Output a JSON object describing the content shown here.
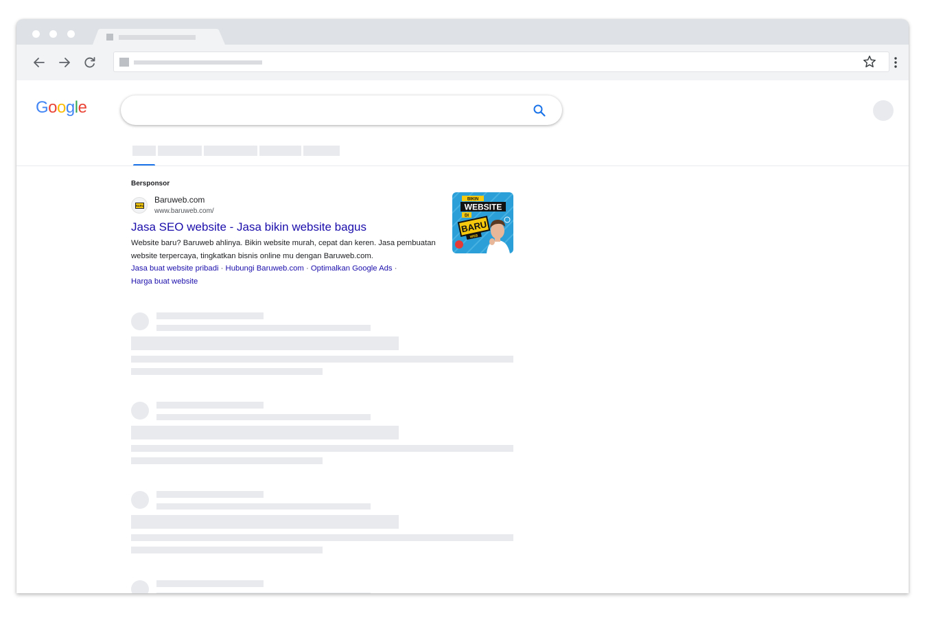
{
  "browser": {
    "tab_title": "",
    "url": ""
  },
  "google": {
    "logo_letters": [
      "G",
      "o",
      "o",
      "g",
      "l",
      "e"
    ],
    "search_query": ""
  },
  "ad": {
    "label": "Bersponsor",
    "site_name": "Baruweb.com",
    "display_url": "www.baruweb.com/",
    "title": "Jasa SEO website - Jasa bikin website bagus",
    "description": "Website baru? Baruweb ahlinya. Bikin website murah, cepat dan keren. Jasa pembuatan website terpercaya, tingkatkan bisnis online mu dengan Baruweb.com.",
    "sitelinks": [
      "Jasa buat website pribadi",
      "Hubungi Baruweb.com",
      "Optimalkan Google Ads",
      "Harga buat website"
    ],
    "sitelink_separator": "·",
    "thumbnail": {
      "line1": "BIKIN",
      "line2": "WEBSITE",
      "line3": "DI",
      "line4": "BARU",
      "line5": "WEB",
      "bg_color": "#2a9fd8",
      "accent_color": "#f6c90e"
    },
    "logo_text": "BARU"
  },
  "colors": {
    "link": "#1a0dab",
    "accent_blue": "#1a73e8",
    "placeholder": "#e8eaed"
  }
}
